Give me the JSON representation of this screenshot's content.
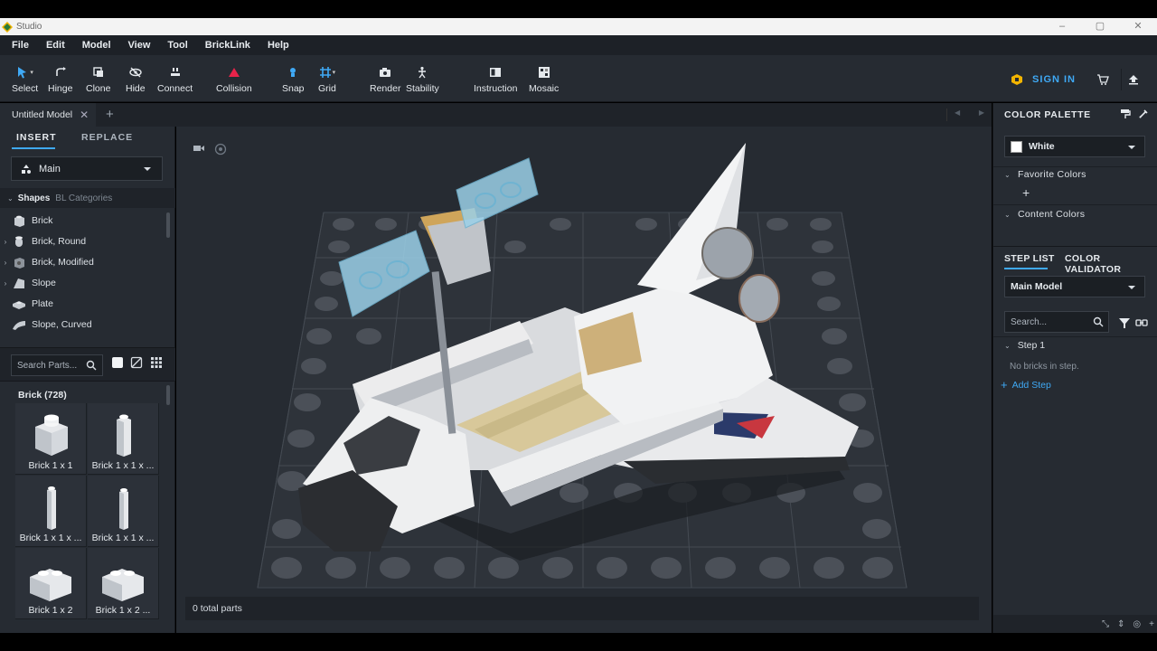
{
  "window": {
    "title": "Studio",
    "controls": [
      "–",
      "▢",
      "✕"
    ]
  },
  "menu": [
    "File",
    "Edit",
    "Model",
    "View",
    "Tool",
    "BrickLink",
    "Help"
  ],
  "toolbar": {
    "tools": [
      {
        "id": "select",
        "label": "Select"
      },
      {
        "id": "hinge",
        "label": "Hinge"
      },
      {
        "id": "clone",
        "label": "Clone"
      },
      {
        "id": "hide",
        "label": "Hide"
      },
      {
        "id": "connect",
        "label": "Connect"
      },
      {
        "id": "collision",
        "label": "Collision"
      },
      {
        "id": "snap",
        "label": "Snap"
      },
      {
        "id": "grid",
        "label": "Grid"
      },
      {
        "id": "render",
        "label": "Render"
      },
      {
        "id": "stability",
        "label": "Stability"
      },
      {
        "id": "instruction",
        "label": "Instruction"
      },
      {
        "id": "mosaic",
        "label": "Mosaic"
      }
    ],
    "sign_in": "SIGN IN",
    "accent": "#3fa9f5"
  },
  "tabs": {
    "document": "Untitled Model",
    "close": "✕",
    "add": "+"
  },
  "left_panel": {
    "tabs": [
      "INSERT",
      "REPLACE"
    ],
    "palette_select": "Main",
    "shape_tabs": [
      "Shapes",
      "BL Categories"
    ],
    "categories": [
      "Brick",
      "Brick, Round",
      "Brick, Modified",
      "Slope",
      "Plate",
      "Slope, Curved"
    ],
    "search_placeholder": "Search Parts...",
    "parts_header": "Brick (728)",
    "parts": [
      "Brick 1 x 1",
      "Brick 1 x 1 x ...",
      "Brick 1 x 1 x ...",
      "Brick 1 x 1 x ...",
      "Brick 1 x 2",
      "Brick 1 x 2 ..."
    ]
  },
  "viewport": {
    "status": "0 total parts"
  },
  "right_panel": {
    "color_palette_title": "COLOR PALETTE",
    "selected_color": "White",
    "favorite_colors": "Favorite Colors",
    "content_colors": "Content Colors",
    "step_tabs": [
      "STEP LIST",
      "COLOR VALIDATOR"
    ],
    "model_select": "Main Model",
    "search_placeholder": "Search...",
    "step_label": "Step 1",
    "no_bricks": "No bricks in step.",
    "add_step": "Add Step"
  }
}
